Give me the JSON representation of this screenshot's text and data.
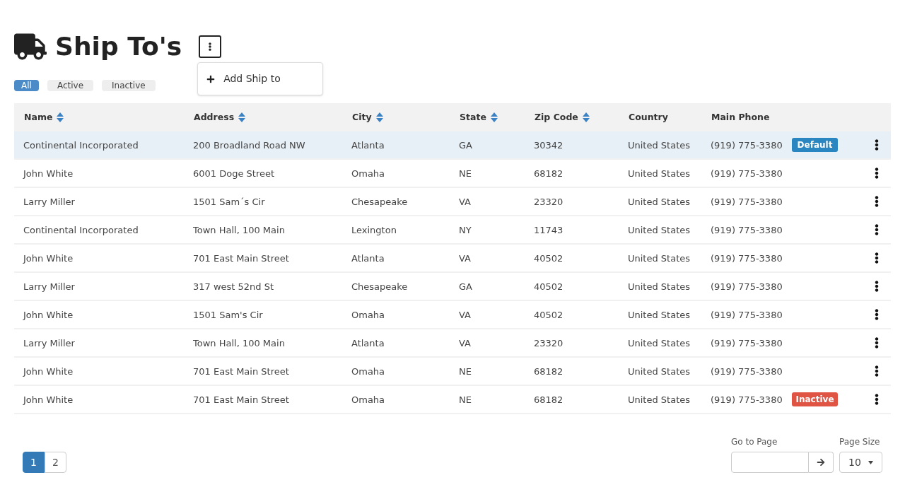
{
  "title": "Ship To's",
  "menu": {
    "open": true,
    "items": [
      {
        "label": "Add Ship to"
      }
    ]
  },
  "filters": [
    {
      "label": "All",
      "selected": true
    },
    {
      "label": "Active",
      "selected": false
    },
    {
      "label": "Inactive",
      "selected": false
    }
  ],
  "table": {
    "columns": [
      {
        "label": "Name",
        "sortable": true
      },
      {
        "label": "Address",
        "sortable": true
      },
      {
        "label": "City",
        "sortable": true
      },
      {
        "label": "State",
        "sortable": true
      },
      {
        "label": "Zip Code",
        "sortable": true
      },
      {
        "label": "Country",
        "sortable": false
      },
      {
        "label": "Main Phone",
        "sortable": false
      }
    ],
    "rows": [
      {
        "selected": true,
        "cells": [
          "Continental Incorporated",
          "200 Broadland Road NW",
          "Atlanta",
          "GA",
          "30342",
          "United States",
          "(919) 775-3380"
        ],
        "badge": {
          "kind": "default",
          "label": "Default"
        }
      },
      {
        "selected": false,
        "cells": [
          "John White",
          "6001 Doge Street",
          "Omaha",
          "NE",
          "68182",
          "United States",
          "(919) 775-3380"
        ]
      },
      {
        "selected": false,
        "cells": [
          "Larry Miller",
          "1501 Sam´s Cir",
          "Chesapeake",
          "VA",
          "23320",
          "United States",
          "(919) 775-3380"
        ]
      },
      {
        "selected": false,
        "cells": [
          "Continental Incorporated",
          "Town Hall, 100 Main",
          "Lexington",
          "NY",
          "11743",
          "United States",
          "(919) 775-3380"
        ]
      },
      {
        "selected": false,
        "cells": [
          "John White",
          "701 East Main Street",
          "Atlanta",
          "VA",
          "40502",
          "United States",
          "(919) 775-3380"
        ]
      },
      {
        "selected": false,
        "cells": [
          "Larry Miller",
          "317 west 52nd St",
          "Chesapeake",
          "GA",
          "40502",
          "United States",
          "(919) 775-3380"
        ]
      },
      {
        "selected": false,
        "cells": [
          "John White",
          "1501 Sam's Cir",
          "Omaha",
          "VA",
          "40502",
          "United States",
          "(919) 775-3380"
        ]
      },
      {
        "selected": false,
        "cells": [
          "Larry Miller",
          "Town Hall, 100 Main",
          "Atlanta",
          "VA",
          "23320",
          "United States",
          "(919) 775-3380"
        ]
      },
      {
        "selected": false,
        "cells": [
          "John White",
          "701 East Main Street",
          "Omaha",
          "NE",
          "68182",
          "United States",
          "(919) 775-3380"
        ]
      },
      {
        "selected": false,
        "cells": [
          "John White",
          "701 East Main Street",
          "Omaha",
          "NE",
          "68182",
          "United States",
          "(919) 775-3380"
        ],
        "badge": {
          "kind": "inactive",
          "label": "Inactive"
        }
      }
    ]
  },
  "pagination": {
    "pages": [
      {
        "label": "1",
        "selected": true
      },
      {
        "label": "2",
        "selected": false
      }
    ]
  },
  "go_to_page": {
    "label": "Go to Page"
  },
  "page_size": {
    "label": "Page Size",
    "value": "10"
  }
}
